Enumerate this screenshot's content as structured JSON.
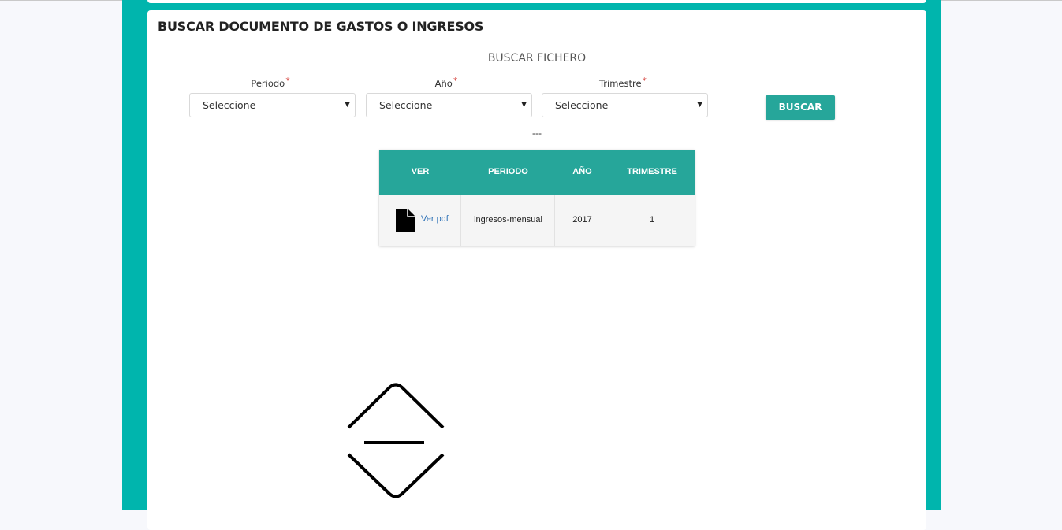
{
  "form": {
    "title": "BUSCAR DOCUMENTO DE GASTOS O INGRESOS",
    "section_title": "BUSCAR FICHERO",
    "required_marker": "*",
    "fields": [
      {
        "label": "Periodo",
        "value": "Seleccione"
      },
      {
        "label": "Año",
        "value": "Seleccione"
      },
      {
        "label": "Trimestre",
        "value": "Seleccione"
      }
    ],
    "search_button": "BUSCAR",
    "divider_text": "---"
  },
  "results": {
    "columns": [
      "VER",
      "PERIODO",
      "AÑO",
      "TRIMESTRE"
    ],
    "rows": [
      {
        "ver": "Ver pdf",
        "periodo": "ingresos-mensual",
        "anio": "2017",
        "trimestre": "1"
      }
    ]
  },
  "colors": {
    "frame": "#00b5ad",
    "header": "#26a69a",
    "link": "#2a6fb6",
    "required": "#d9534f"
  },
  "icons": [
    "pdf-file-icon",
    "chevron-down-icon",
    "scroll-up-down-icon"
  ]
}
